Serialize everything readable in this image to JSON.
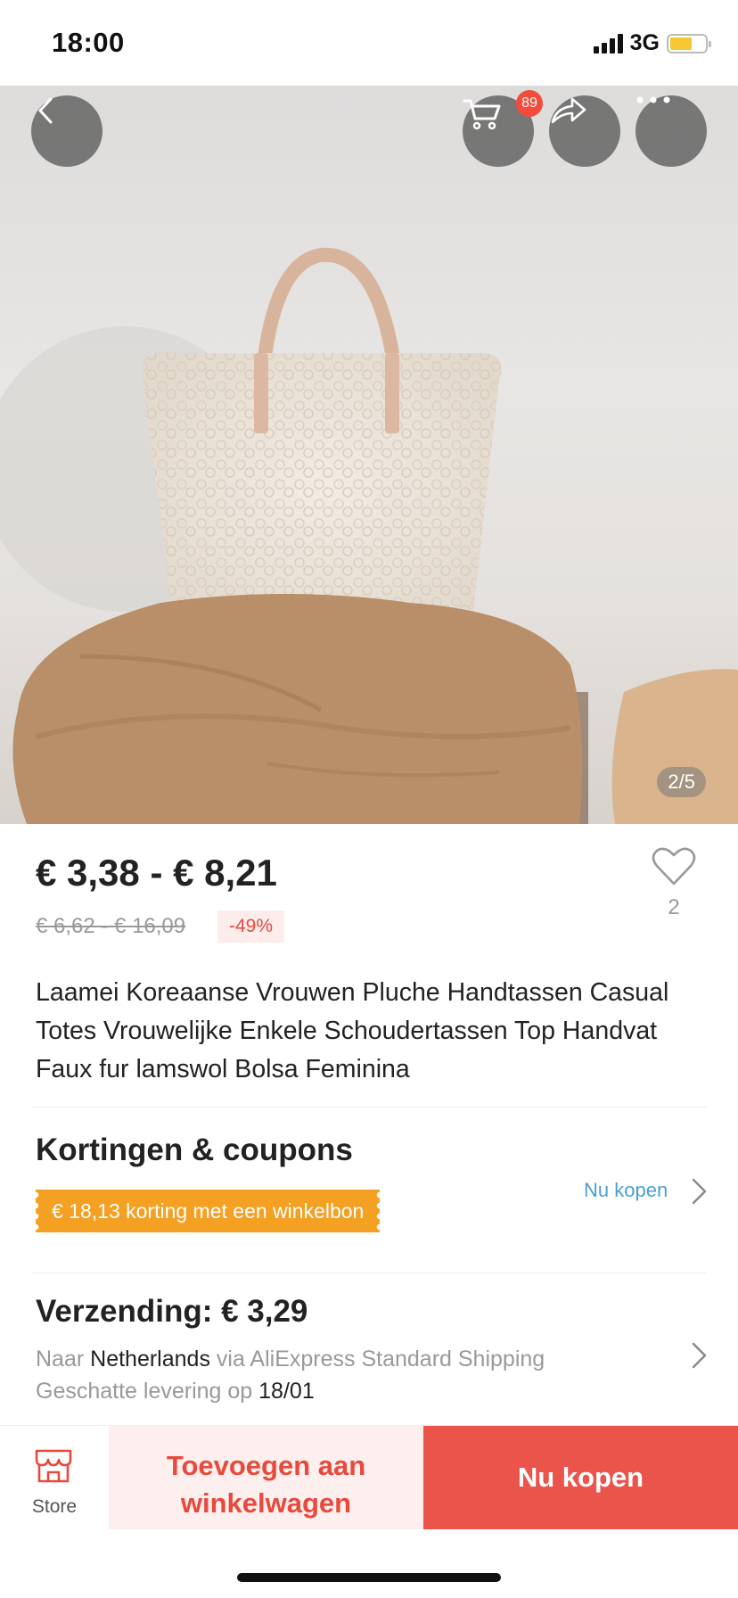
{
  "status_bar": {
    "time": "18:00",
    "network": "3G",
    "battery_color": "#f6c832"
  },
  "header": {
    "back_icon": "chevron-left-icon",
    "cart_icon": "cart-icon",
    "cart_badge": "89",
    "share_icon": "share-icon",
    "more_icon": "more-dots-icon"
  },
  "gallery": {
    "indicator": "2/5"
  },
  "price": {
    "range": "€ 3,38 - € 8,21",
    "original_range": "€ 6,62 - € 16,09",
    "discount": "-49%"
  },
  "wishlist": {
    "count": "2",
    "icon": "heart-icon"
  },
  "product": {
    "title": "Laamei Koreaanse Vrouwen Pluche Handtassen Casual Totes Vrouwelijke Enkele Schoudertassen Top Handvat Faux fur lamswol Bolsa Feminina"
  },
  "coupons": {
    "heading": "Kortingen & coupons",
    "coupon_text": "€ 18,13 korting met een winkelbon",
    "link": "Nu kopen"
  },
  "shipping": {
    "heading": "Verzending: € 3,29",
    "to_label": "Naar",
    "country": "Netherlands",
    "via_text": "via AliExpress Standard Shipping",
    "delivery_label": "Geschatte levering op",
    "delivery_date": "18/01"
  },
  "bottom_bar": {
    "store_label": "Store",
    "add_to_cart": "Toevoegen aan winkelwagen",
    "buy_now": "Nu kopen"
  },
  "colors": {
    "accent_red": "#eb544b",
    "coupon_orange": "#f4a023",
    "link_blue": "#4a9fd0"
  }
}
